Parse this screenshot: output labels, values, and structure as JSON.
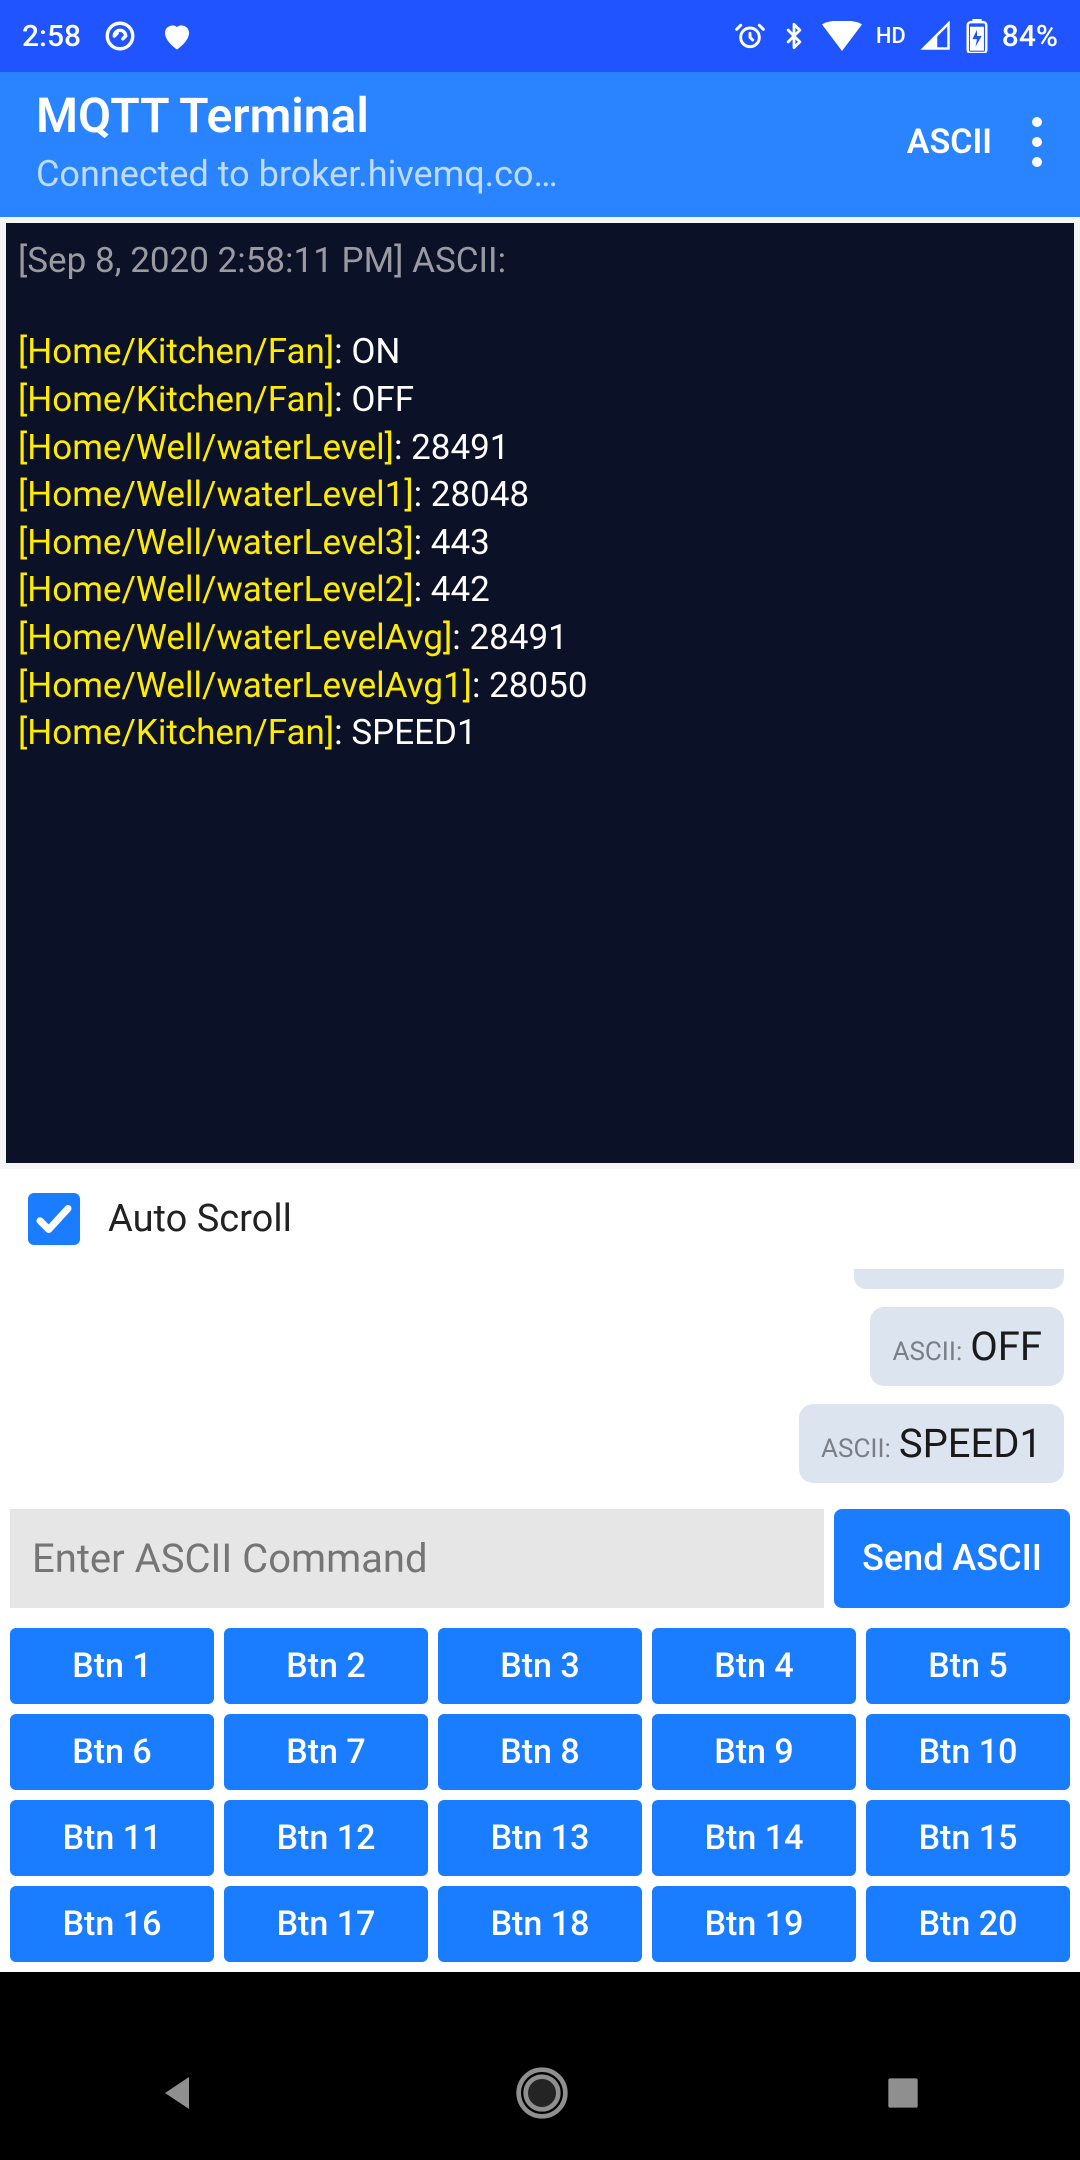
{
  "status": {
    "time": "2:58",
    "battery": "84%",
    "wifi_label": "HD"
  },
  "app": {
    "title": "MQTT Terminal",
    "subtitle": "Connected to broker.hivemq.co…",
    "action_ascii": "ASCII"
  },
  "terminal": {
    "header": "[Sep 8, 2020 2:58:11 PM] ASCII:",
    "lines": [
      {
        "topic": "[Home/Kitchen/Fan]",
        "value": "ON"
      },
      {
        "topic": "[Home/Kitchen/Fan]",
        "value": "OFF"
      },
      {
        "topic": "[Home/Well/waterLevel]",
        "value": "28491"
      },
      {
        "topic": "[Home/Well/waterLevel1]",
        "value": "28048"
      },
      {
        "topic": "[Home/Well/waterLevel3]",
        "value": "443"
      },
      {
        "topic": "[Home/Well/waterLevel2]",
        "value": "442"
      },
      {
        "topic": "[Home/Well/waterLevelAvg]",
        "value": "28491"
      },
      {
        "topic": "[Home/Well/waterLevelAvg1]",
        "value": "28050"
      },
      {
        "topic": "[Home/Kitchen/Fan]",
        "value": "SPEED1"
      }
    ]
  },
  "autoscroll": {
    "label": "Auto Scroll",
    "checked": true
  },
  "sent": [
    {
      "prefix": "ASCII:",
      "payload": "OFF"
    },
    {
      "prefix": "ASCII:",
      "payload": "SPEED1"
    }
  ],
  "cmd": {
    "placeholder": "Enter ASCII Command",
    "send_label": "Send ASCII"
  },
  "buttons": [
    "Btn 1",
    "Btn 2",
    "Btn 3",
    "Btn 4",
    "Btn 5",
    "Btn 6",
    "Btn 7",
    "Btn 8",
    "Btn 9",
    "Btn 10",
    "Btn 11",
    "Btn 12",
    "Btn 13",
    "Btn 14",
    "Btn 15",
    "Btn 16",
    "Btn 17",
    "Btn 18",
    "Btn 19",
    "Btn 20"
  ]
}
